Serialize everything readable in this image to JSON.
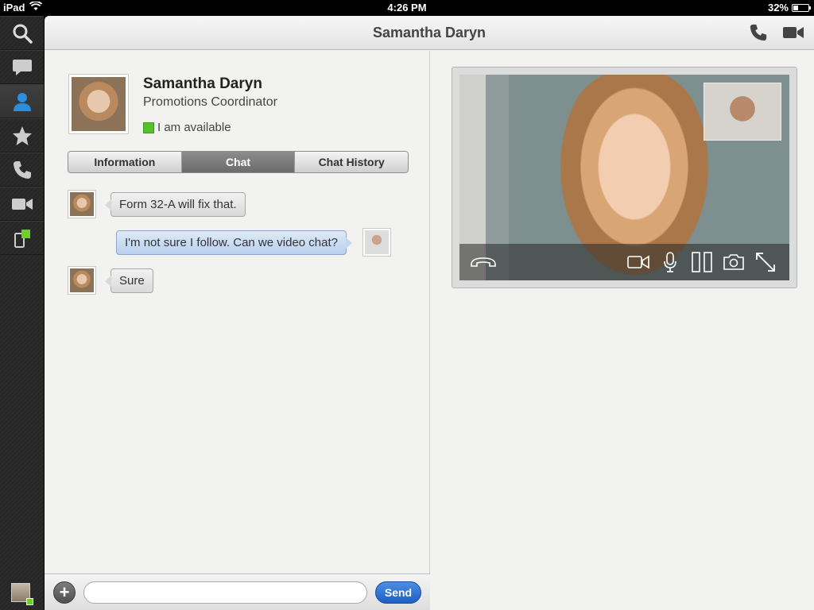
{
  "status_bar": {
    "device": "iPad",
    "time": "4:26 PM",
    "battery": "32%",
    "battery_level": 0.32
  },
  "rail": {
    "items": [
      {
        "icon": "search-icon"
      },
      {
        "icon": "chat-bubble-icon"
      },
      {
        "icon": "contact-person-icon",
        "active": true
      },
      {
        "icon": "star-icon"
      },
      {
        "icon": "phone-icon"
      },
      {
        "icon": "video-camera-icon"
      },
      {
        "icon": "device-transfer-icon"
      }
    ]
  },
  "navbar": {
    "title": "Samantha Daryn"
  },
  "contact": {
    "name": "Samantha Daryn",
    "role": "Promotions Coordinator",
    "status": "I am available",
    "status_color": "#55c12a"
  },
  "tabs": [
    {
      "label": "Information",
      "active": false
    },
    {
      "label": "Chat",
      "active": true
    },
    {
      "label": "Chat History",
      "active": false
    }
  ],
  "chat": {
    "messages": [
      {
        "from": "contact",
        "text": "Form 32-A will fix that."
      },
      {
        "from": "me",
        "text": "I'm not sure I follow. Can we video chat?"
      },
      {
        "from": "contact",
        "text": "Sure"
      }
    ]
  },
  "composer": {
    "placeholder": "",
    "send_label": "Send"
  },
  "colors": {
    "accent": "#2a6fd3",
    "available": "#55c12a"
  }
}
